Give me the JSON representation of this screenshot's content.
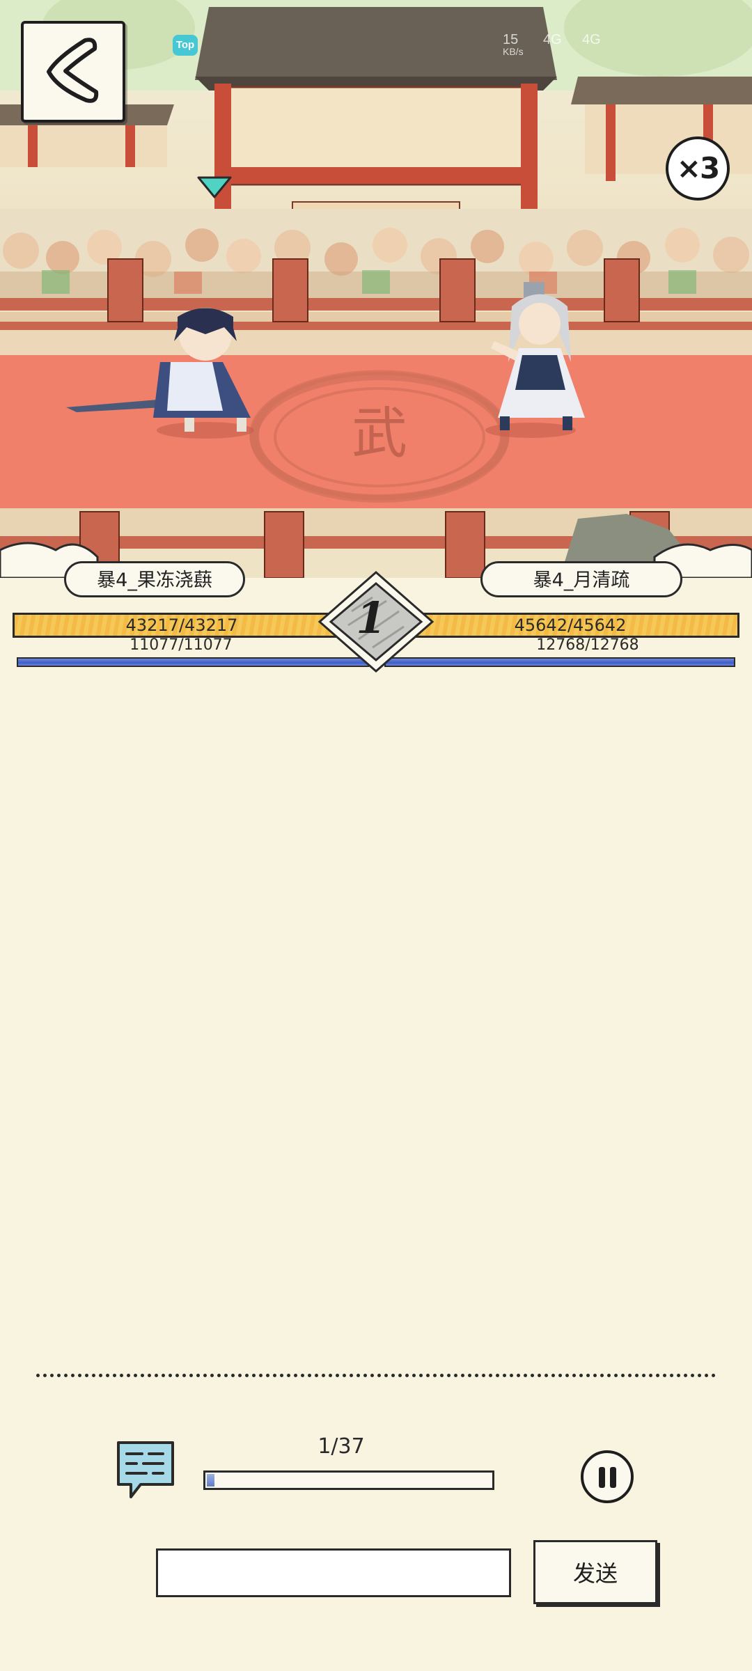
{
  "status_bar": {
    "time": "15",
    "network_speed": "KB/s",
    "network_type": "4G",
    "network_type_secondary": "4G",
    "badge_label": "Top"
  },
  "battle": {
    "speed_multiplier": "×3",
    "round": "1",
    "arena_emblem": "武",
    "player": {
      "name": "暴4_果冻浇蕻",
      "hp_text": "43217/43217",
      "mp_text": "11077/11077",
      "hp_fraction": 1.0,
      "mp_fraction": 1.0
    },
    "enemy": {
      "name": "暴4_月清疏",
      "hp_text": "45642/45642",
      "mp_text": "12768/12768",
      "hp_fraction": 1.0,
      "mp_fraction": 1.0
    }
  },
  "playback": {
    "progress_text": "1/37",
    "progress_fraction": 0.027,
    "chat_icon": "chat-bubble-icon",
    "pause_icon": "pause-icon"
  },
  "chat": {
    "input_value": "",
    "send_label": "发送"
  },
  "colors": {
    "background": "#f8f4e0",
    "hp_fill": "#f3bb46",
    "mp_fill": "#3f5ec6",
    "arena_floor": "#f0806a",
    "outline": "#2a2a2a",
    "turn_marker": "#4fd4c4"
  }
}
